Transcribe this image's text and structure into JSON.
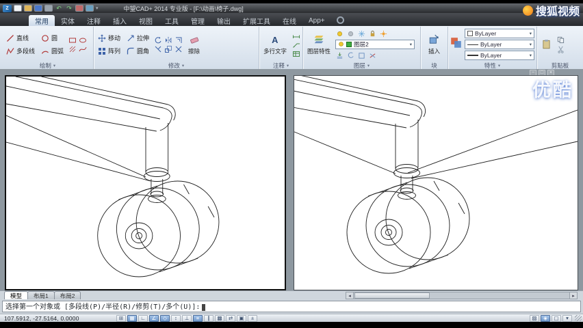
{
  "window": {
    "title": "中望CAD+ 2014 专业版 - [F:\\动画\\椅子.dwg]"
  },
  "watermarks": {
    "sohu": "搜狐视频",
    "youku": "优酷"
  },
  "ribbon": {
    "tabs": [
      {
        "label": "常用"
      },
      {
        "label": "实体"
      },
      {
        "label": "注释"
      },
      {
        "label": "插入"
      },
      {
        "label": "视图"
      },
      {
        "label": "工具"
      },
      {
        "label": "管理"
      },
      {
        "label": "输出"
      },
      {
        "label": "扩展工具"
      },
      {
        "label": "在线"
      },
      {
        "label": "App+"
      }
    ],
    "panels": {
      "draw": {
        "label": "绘制",
        "line": "直线",
        "polyline": "多段线",
        "circle": "圆",
        "arc": "圆弧"
      },
      "modify": {
        "label": "修改",
        "move": "移动",
        "array": "阵列",
        "stretch": "拉伸",
        "fillet": "圆角",
        "erase": "擦除"
      },
      "annotate": {
        "label": "注释",
        "mtext": "多行文字"
      },
      "layer": {
        "label": "图层",
        "layer_properties": "图层特性",
        "current_layer": "图层2"
      },
      "block": {
        "label": "块",
        "insert": "插入"
      },
      "properties": {
        "label": "特性",
        "color": "ByLayer",
        "linetype": "ByLayer",
        "lineweight": "ByLayer"
      },
      "clipboard": {
        "label": "剪贴板"
      }
    }
  },
  "layout_tabs": [
    {
      "label": "模型"
    },
    {
      "label": "布局1"
    },
    {
      "label": "布局2"
    }
  ],
  "command_line": {
    "prompt": "选择第一个对象或 [多段线(P)/半径(R)/修剪(T)/多个(U)]:"
  },
  "status_bar": {
    "coordinates": "107.5912, -27.5164, 0.0000"
  }
}
